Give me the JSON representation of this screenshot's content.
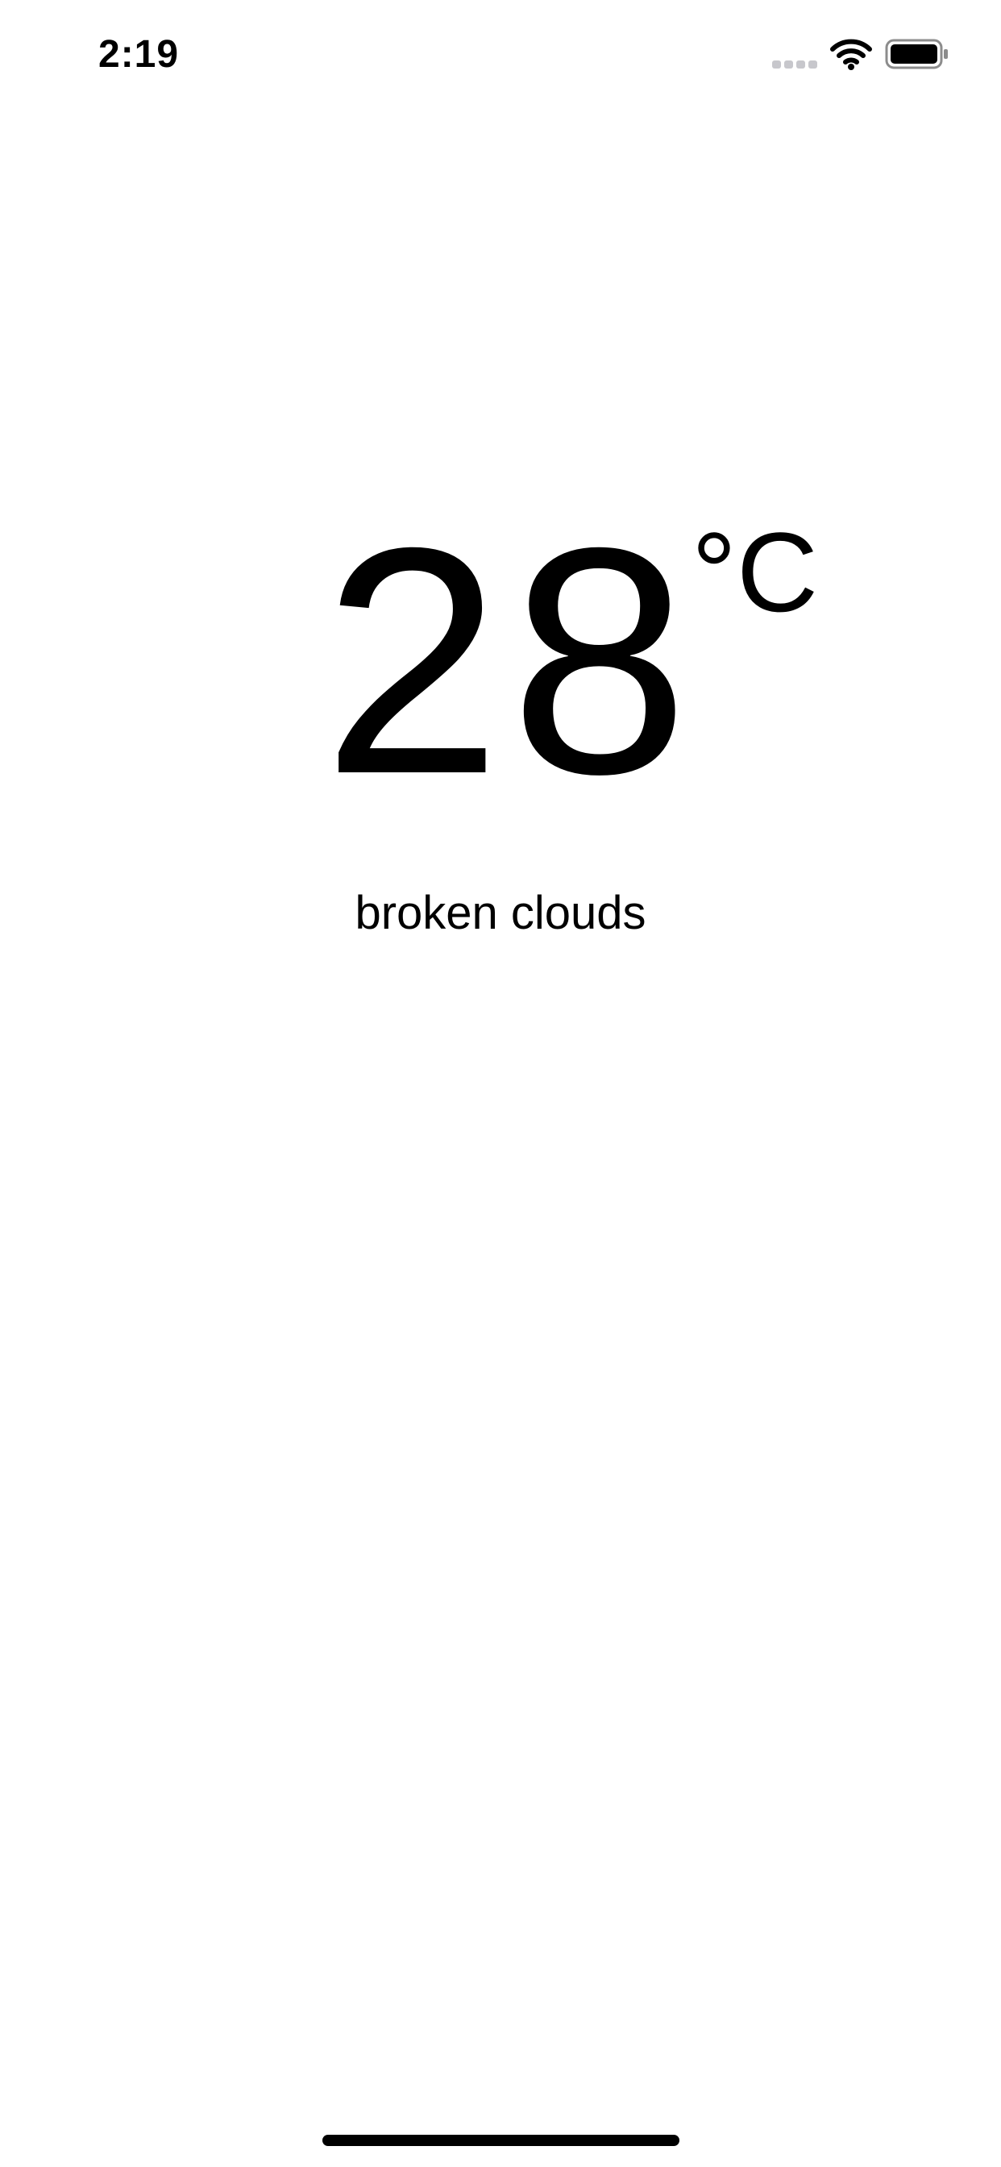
{
  "status_bar": {
    "time": "2:19",
    "icons": [
      "signal-dots-icon",
      "wifi-icon",
      "battery-icon"
    ],
    "signal_color": "#c7c7cc"
  },
  "weather": {
    "temperature": "28",
    "unit": "°C",
    "condition": "broken clouds"
  },
  "colors": {
    "background": "#ffffff",
    "text": "#000000"
  }
}
